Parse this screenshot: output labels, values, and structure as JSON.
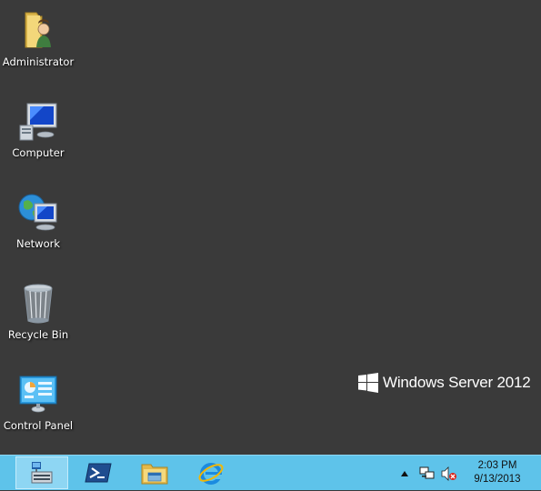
{
  "desktop": {
    "icons": [
      {
        "label": "Administrator",
        "icon": "user-folder-icon"
      },
      {
        "label": "Computer",
        "icon": "computer-icon"
      },
      {
        "label": "Network",
        "icon": "network-globe-icon"
      },
      {
        "label": "Recycle Bin",
        "icon": "recycle-bin-icon"
      },
      {
        "label": "Control Panel",
        "icon": "control-panel-icon"
      }
    ],
    "branding": "Windows Server 2012"
  },
  "taskbar": {
    "buttons": [
      {
        "name": "server-manager",
        "icon": "server-manager-icon"
      },
      {
        "name": "powershell",
        "icon": "powershell-icon"
      },
      {
        "name": "file-explorer",
        "icon": "file-explorer-icon"
      },
      {
        "name": "internet-explorer",
        "icon": "internet-explorer-icon"
      }
    ],
    "tray": {
      "overflow_icon": "chevron-up-icon",
      "network_icon": "network-status-icon",
      "volume_icon": "volume-muted-icon"
    },
    "clock": {
      "time": "2:03 PM",
      "date": "9/13/2013"
    }
  },
  "colors": {
    "desktop_bg": "#3a3a3a",
    "taskbar_bg": "#5ec3ea",
    "active_button_bg": "#8ed6f3"
  }
}
